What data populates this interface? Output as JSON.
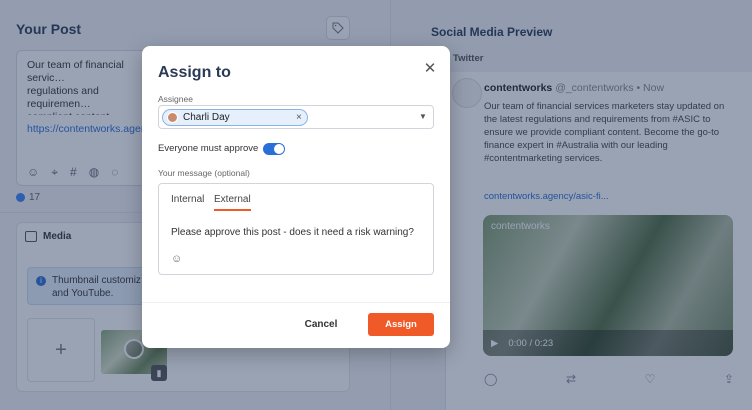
{
  "left": {
    "title": "Your Post",
    "post_text": "Our team of financial servic…\nregulations and requiremen…\ncompliant content. Becom…\nour leading #contentmarke…",
    "post_link": "https://contentworks.agenc…",
    "tool_icons": [
      "smile-icon",
      "location-icon",
      "hashtag-icon",
      "globe-icon",
      "chat-icon"
    ],
    "count": "17",
    "media_title": "Media",
    "info_text": "Thumbnail customiz… and YouTube.",
    "add_symbol": "+"
  },
  "right": {
    "title": "Social Media Preview",
    "network": "Twitter",
    "tweet": {
      "handle": "contentworks",
      "meta": "@_contentworks • Now",
      "body": "Our team of financial services marketers stay updated on the latest regulations and requirements from #ASIC to ensure we provide compliant content. Become the go-to finance expert in #Australia with our leading #contentmarketing services.",
      "link": "contentworks.agency/asic-fi...",
      "video_brand": "contentworks",
      "video_time": "0:00 / 0:23"
    }
  },
  "modal": {
    "title": "Assign to",
    "assignee_label": "Assignee",
    "assignee_name": "Charli Day",
    "toggle_label": "Everyone must approve",
    "toggle_on": true,
    "message_label": "Your message (optional)",
    "tabs": [
      "Internal",
      "External"
    ],
    "active_tab": "External",
    "message_text": "Please approve this post - does it need a risk warning?",
    "cancel_label": "Cancel",
    "assign_label": "Assign",
    "accent_color": "#f05a28",
    "toggle_color": "#2a6ed8"
  }
}
